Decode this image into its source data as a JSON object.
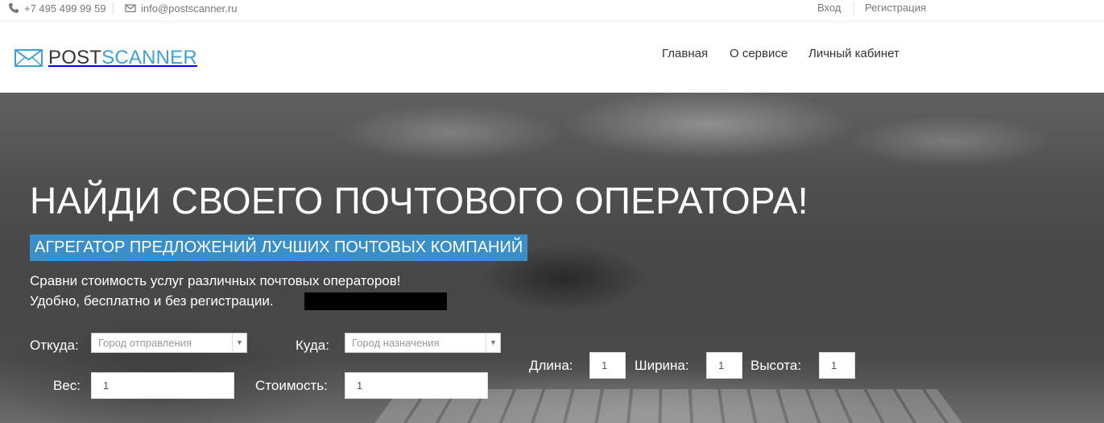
{
  "topbar": {
    "phone": "+7 495 499 99 59",
    "email": "info@postscanner.ru",
    "login": "Вход",
    "register": "Регистрация"
  },
  "logo": {
    "part1": "POST",
    "part2": "SCANNER"
  },
  "nav": {
    "home": "Главная",
    "about": "О сервисе",
    "cabinet": "Личный кабинет"
  },
  "hero": {
    "title": "НАЙДИ СВОЕГО ПОЧТОВОГО ОПЕРАТОРА!",
    "tagline": "АГРЕГАТОР ПРЕДЛОЖЕНИЙ ЛУЧШИХ ПОЧТОВЫХ КОМПАНИЙ",
    "line1": "Сравни стоимость услуг различных почтовых операторов!",
    "line2": "Удобно, бесплатно и без регистрации."
  },
  "form": {
    "from_label": "Откуда:",
    "from_placeholder": "Город отправления",
    "to_label": "Куда:",
    "to_placeholder": "Город назначения",
    "length_label": "Длина:",
    "length_value": "1",
    "width_label": "Ширина:",
    "width_value": "1",
    "height_label": "Высота:",
    "height_value": "1",
    "weight_label": "Вес:",
    "weight_value": "1",
    "cost_label": "Стоимость:",
    "cost_value": "1"
  },
  "colors": {
    "accent": "#3a8fc8",
    "logo_blue": "#3fa0d6"
  }
}
